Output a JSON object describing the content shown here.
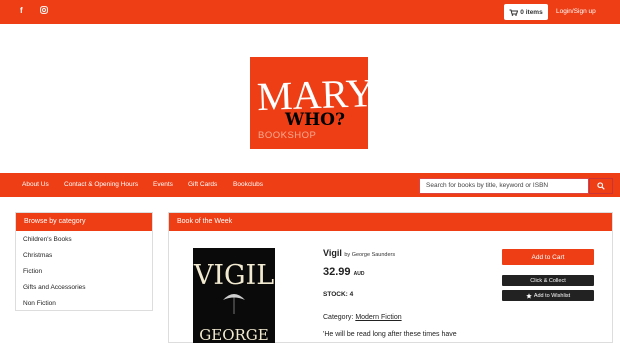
{
  "topbar": {
    "social": [
      "facebook-icon",
      "instagram-icon"
    ],
    "cart_label": "0 items",
    "login_label": "Login/Sign up"
  },
  "logo": {
    "mary": "MARY",
    "who": "WHO?",
    "bookshop": "BOOKSHOP"
  },
  "nav": {
    "items": [
      "About Us",
      "Contact & Opening Hours",
      "Events",
      "Gift Cards",
      "Bookclubs"
    ]
  },
  "search": {
    "placeholder": "Search for books by title, keyword or ISBN"
  },
  "sidebar": {
    "title": "Browse by category",
    "categories": [
      "Children's Books",
      "Christmas",
      "Fiction",
      "Gifts and Accessories",
      "Non Fiction"
    ]
  },
  "book_of_week": {
    "heading": "Book of the Week",
    "title": "Vigil",
    "by_author": "by George Saunders",
    "price": "32.99",
    "currency": "AUD",
    "stock": "STOCK: 4",
    "category_label": "Category:",
    "category": "Modern Fiction",
    "quote": "'He will be read long after these times have",
    "cover_title": "VIGIL",
    "cover_author": "GEORGE",
    "add_to_cart": "Add to Cart",
    "click_collect": "Click & Collect",
    "add_wishlist": "Add to Wishlist"
  },
  "colors": {
    "brand": "#ee3e15",
    "dark": "#222222"
  }
}
